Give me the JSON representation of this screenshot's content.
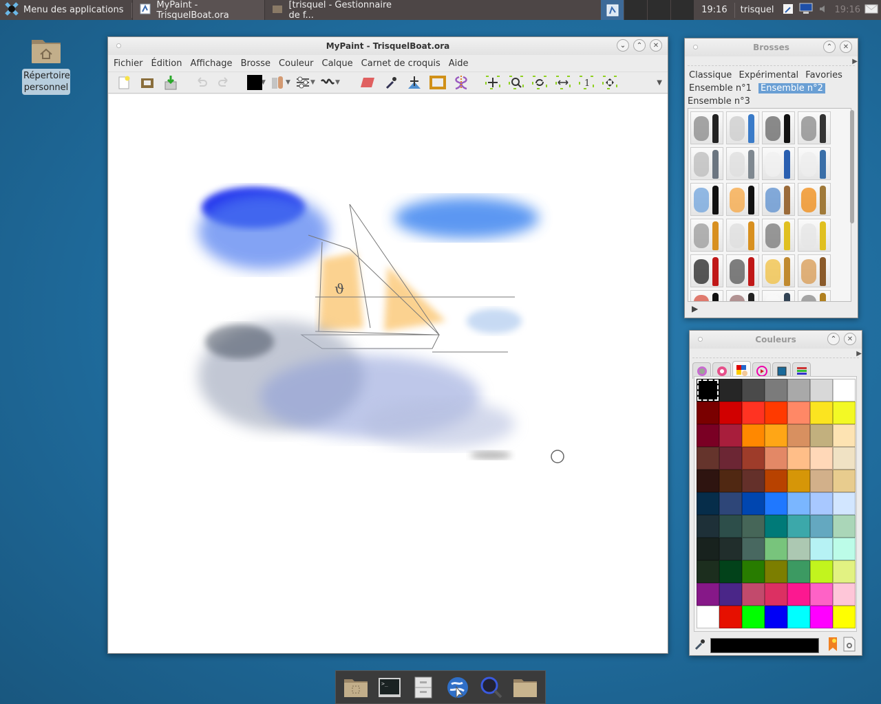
{
  "top_panel": {
    "app_menu_label": "Menu des applications",
    "tasks": [
      {
        "label": "MyPaint - TrisquelBoat.ora",
        "icon": "mypaint-icon",
        "active": true
      },
      {
        "label": "[trisquel - Gestionnaire de f...",
        "icon": "folder-home-icon",
        "active": false
      }
    ],
    "workspaces": 4,
    "current_workspace": 1,
    "clock": "19:16",
    "user": "trisquel",
    "tray_clock": "19:16",
    "tray_icons": [
      "network-key-icon",
      "monitor-icon",
      "volume-icon",
      "mail-icon"
    ]
  },
  "desktop": {
    "home_icon_label": "Répertoire personnel"
  },
  "main_window": {
    "title": "MyPaint - TrisquelBoat.ora",
    "menu": [
      "Fichier",
      "Édition",
      "Affichage",
      "Brosse",
      "Couleur",
      "Calque",
      "Carnet de croquis",
      "Aide"
    ],
    "toolbar": {
      "file": [
        "new-document-icon",
        "open-file-icon",
        "save-file-icon"
      ],
      "history": [
        "undo-icon",
        "redo-icon"
      ],
      "current_color": "#000000",
      "tools": [
        "brush-settings-icon",
        "adjustments-icon",
        "stroke-shape-icon",
        "eraser-icon",
        "color-picker-icon",
        "layer-move-icon",
        "frame-icon",
        "symmetry-icon"
      ],
      "view": [
        "pan-view-icon",
        "zoom-view-icon",
        "rotate-view-icon",
        "mirror-view-icon",
        "reset-view-icon",
        "fit-view-icon"
      ],
      "overflow": "overflow-menu-icon"
    },
    "canvas": {
      "document": "TrisquelBoat.ora",
      "description": "watercolor sailboat on sea with blue sky"
    }
  },
  "brushes_panel": {
    "title": "Brosses",
    "groups": [
      "Classique",
      "Expérimental",
      "Favories",
      "Ensemble n°1",
      "Ensemble n°2",
      "Ensemble n°3"
    ],
    "selected_group": "Ensemble n°2",
    "brushes": [
      {
        "stroke": "#888888",
        "tool": "#222222"
      },
      {
        "stroke": "#cccccc",
        "tool": "#3a7bc8"
      },
      {
        "stroke": "#666666",
        "tool": "#111111"
      },
      {
        "stroke": "#888888",
        "tool": "#333333"
      },
      {
        "stroke": "#bbbbbb",
        "tool": "#6b7580"
      },
      {
        "stroke": "#dddddd",
        "tool": "#7f8890"
      },
      {
        "stroke": "#f0f0f0",
        "tool": "#2a5fb0"
      },
      {
        "stroke": "#eeeeee",
        "tool": "#3a6fa8"
      },
      {
        "stroke": "#6fa3dc",
        "tool": "#111111"
      },
      {
        "stroke": "#f7a640",
        "tool": "#111111"
      },
      {
        "stroke": "#5b8fcf",
        "tool": "#9b6b3a"
      },
      {
        "stroke": "#f08a10",
        "tool": "#a07a3a"
      },
      {
        "stroke": "#999999",
        "tool": "#d89020"
      },
      {
        "stroke": "#dddddd",
        "tool": "#d89020"
      },
      {
        "stroke": "#777777",
        "tool": "#e0c020"
      },
      {
        "stroke": "#e5e5e5",
        "tool": "#e0c020"
      },
      {
        "stroke": "#222222",
        "tool": "#c01818"
      },
      {
        "stroke": "#555555",
        "tool": "#c01818"
      },
      {
        "stroke": "#f2c040",
        "tool": "#c08a30"
      },
      {
        "stroke": "#d89a50",
        "tool": "#8a5a2a"
      },
      {
        "stroke": "#d85040",
        "tool": "#111111"
      },
      {
        "stroke": "#9a7070",
        "tool": "#222222"
      },
      {
        "stroke": "#f8f8f8",
        "tool": "#334455"
      },
      {
        "stroke": "#888888",
        "tool": "#b08020"
      }
    ]
  },
  "colors_panel": {
    "title": "Couleurs",
    "tabs": [
      "hsv-wheel-icon",
      "color-wheel-icon",
      "palette-icon",
      "hcy-wheel-icon",
      "hsv-square-icon",
      "component-sliders-icon"
    ],
    "active_tab": 2,
    "current_color": "#000000",
    "palette": [
      "#000000",
      "#262626",
      "#4a4a4a",
      "#7b7b7b",
      "#a9a9a9",
      "#d8d8d8",
      "#ffffff",
      "#7a0000",
      "#d10000",
      "#ff3322",
      "#ff3a00",
      "#ff8866",
      "#fbe420",
      "#f3f925",
      "#7a0024",
      "#a81e3c",
      "#ff8800",
      "#ffa616",
      "#d89060",
      "#c2b07e",
      "#fde3b2",
      "#65342c",
      "#6c2634",
      "#9e3c2a",
      "#e38866",
      "#ffbe88",
      "#ffd8b8",
      "#f0e2c4",
      "#2e1410",
      "#502812",
      "#64302a",
      "#b84200",
      "#d69608",
      "#d2b08a",
      "#e8cc8e",
      "#062d4a",
      "#2e4678",
      "#0046b0",
      "#1f78ff",
      "#7ab6ff",
      "#a8c8ff",
      "#d2e6ff",
      "#1e3038",
      "#2d4e4a",
      "#466658",
      "#007a78",
      "#3ca8aa",
      "#64a8c0",
      "#aad6b8",
      "#18221e",
      "#212e2c",
      "#486860",
      "#78c47c",
      "#acc8b2",
      "#b6f2f4",
      "#bcfce8",
      "#1c2e1e",
      "#02421a",
      "#287c00",
      "#7c7e00",
      "#3c9a62",
      "#c2f41e",
      "#e2f282",
      "#861888",
      "#4a2688",
      "#c24a6c",
      "#dc3062",
      "#fc1890",
      "#fe62c6",
      "#fec6d8",
      "#ffffff",
      "#e61000",
      "#00ff00",
      "#0000f6",
      "#00ffff",
      "#ff00ff",
      "#ffff00"
    ],
    "selected_swatch": 0
  },
  "dock": {
    "items": [
      "folder-documents-icon",
      "terminal-icon",
      "file-cabinet-icon",
      "web-browser-icon",
      "search-icon",
      "folder-icon"
    ]
  }
}
